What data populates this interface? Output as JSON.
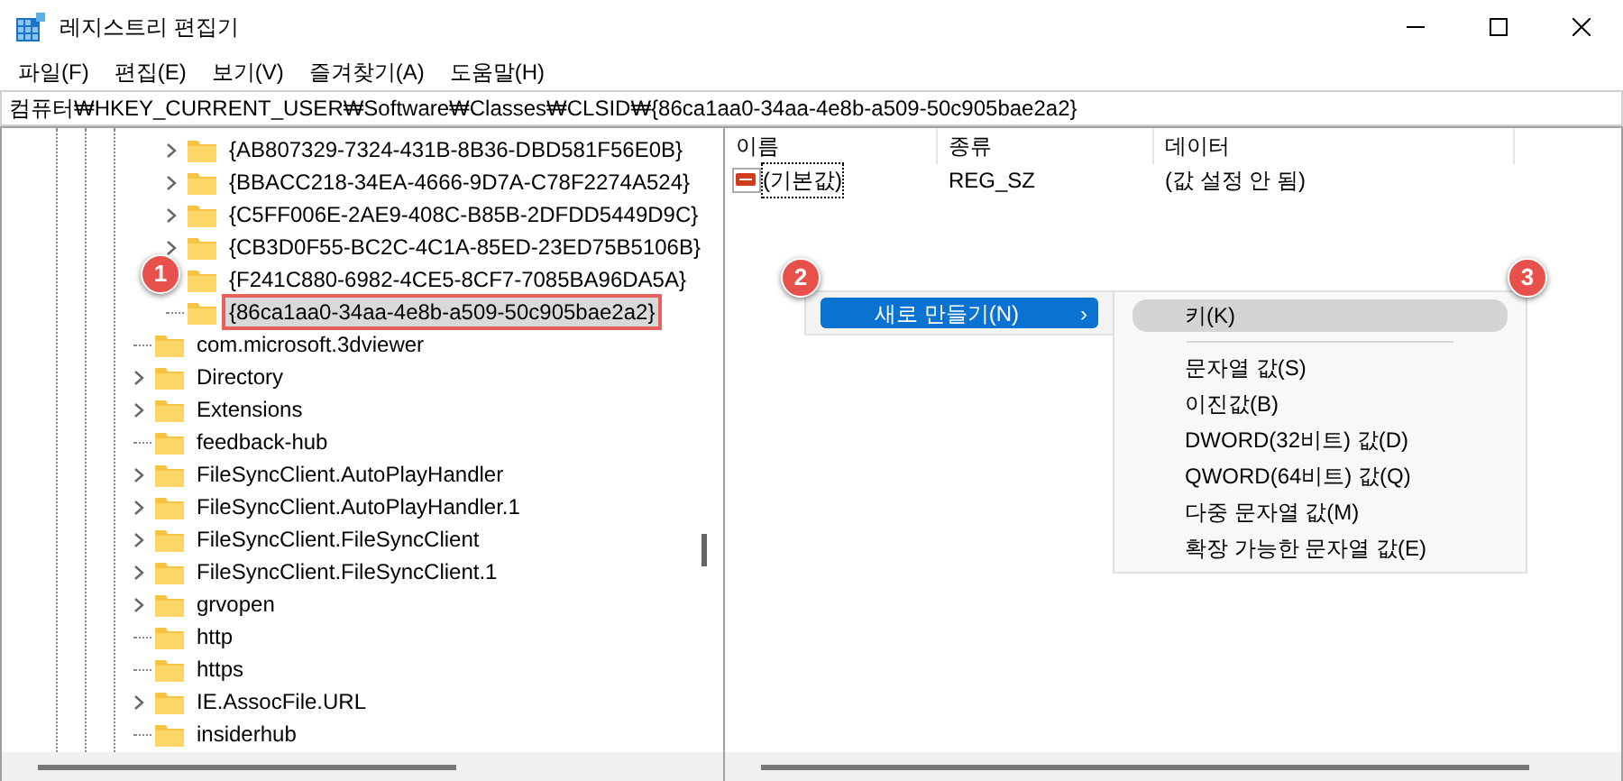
{
  "window": {
    "title": "레지스트리 편집기"
  },
  "menu_bar": [
    "파일(F)",
    "편집(E)",
    "보기(V)",
    "즐겨찾기(A)",
    "도움말(H)"
  ],
  "address_bar": {
    "value": "컴퓨터₩HKEY_CURRENT_USER₩Software₩Classes₩CLSID₩{86ca1aa0-34aa-4e8b-a509-50c905bae2a2}"
  },
  "tree": {
    "clsid_keys": [
      {
        "label": "{AB807329-7324-431B-8B36-DBD581F56E0B}",
        "expandable": true,
        "selected": false
      },
      {
        "label": "{BBACC218-34EA-4666-9D7A-C78F2274A524}",
        "expandable": true,
        "selected": false
      },
      {
        "label": "{C5FF006E-2AE9-408C-B85B-2DFDD5449D9C}",
        "expandable": true,
        "selected": false
      },
      {
        "label": "{CB3D0F55-BC2C-4C1A-85ED-23ED75B5106B}",
        "expandable": true,
        "selected": false
      },
      {
        "label": "{F241C880-6982-4CE5-8CF7-7085BA96DA5A}",
        "selected": false
      },
      {
        "label": "{86ca1aa0-34aa-4e8b-a509-50c905bae2a2}",
        "expandable": false,
        "selected": true
      }
    ],
    "class_keys": [
      {
        "label": "com.microsoft.3dviewer",
        "expandable": false,
        "selected": false
      },
      {
        "label": "Directory",
        "expandable": true,
        "selected": false
      },
      {
        "label": "Extensions",
        "expandable": true,
        "selected": false
      },
      {
        "label": "feedback-hub",
        "expandable": false,
        "selected": false
      },
      {
        "label": "FileSyncClient.AutoPlayHandler",
        "expandable": true,
        "selected": false
      },
      {
        "label": "FileSyncClient.AutoPlayHandler.1",
        "expandable": true,
        "selected": false
      },
      {
        "label": "FileSyncClient.FileSyncClient",
        "expandable": true,
        "selected": false
      },
      {
        "label": "FileSyncClient.FileSyncClient.1",
        "expandable": true,
        "selected": false
      },
      {
        "label": "grvopen",
        "expandable": true,
        "selected": false
      },
      {
        "label": "http",
        "expandable": false,
        "selected": false
      },
      {
        "label": "https",
        "expandable": false,
        "selected": false
      },
      {
        "label": "IE.AssocFile.URL",
        "expandable": true,
        "selected": false
      },
      {
        "label": "insiderhub",
        "expandable": false,
        "selected": false
      }
    ]
  },
  "values": {
    "columns": [
      "이름",
      "종류",
      "데이터"
    ],
    "rows": [
      {
        "name": "(기본값)",
        "type": "REG_SZ",
        "data": "(값 설정 안 됨)",
        "selected": true
      }
    ]
  },
  "context_menu": {
    "items": [
      {
        "label": "새로 만들기(N)",
        "arrow": "›",
        "selected": true
      }
    ]
  },
  "submenu": {
    "items": [
      {
        "label": "키(K)",
        "selected": true,
        "separator_after": true
      },
      {
        "label": "문자열 값(S)",
        "selected": false,
        "separator_after": false
      },
      {
        "label": "이진값(B)",
        "selected": false,
        "separator_after": false
      },
      {
        "label": "DWORD(32비트) 값(D)",
        "selected": false,
        "separator_after": false
      },
      {
        "label": "QWORD(64비트) 값(Q)",
        "selected": false,
        "separator_after": false
      },
      {
        "label": "다중 문자열 값(M)",
        "selected": false,
        "separator_after": false
      },
      {
        "label": "확장 가능한 문자열 값(E)",
        "selected": false,
        "separator_after": false
      }
    ]
  },
  "callouts": [
    "1",
    "2",
    "3"
  ]
}
